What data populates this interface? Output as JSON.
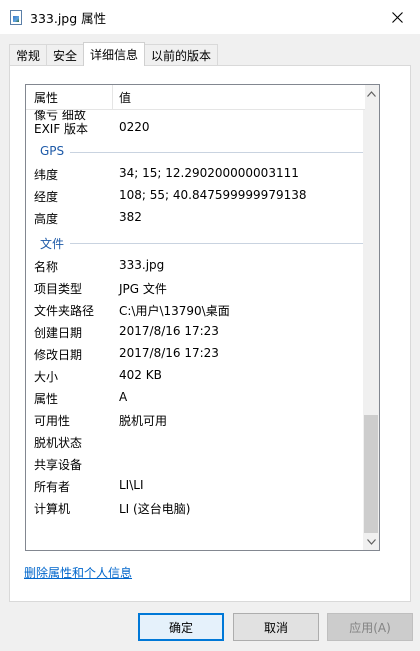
{
  "window": {
    "title": "333.jpg 属性"
  },
  "tabs": [
    {
      "label": "常规",
      "active": false
    },
    {
      "label": "安全",
      "active": false
    },
    {
      "label": "详细信息",
      "active": true
    },
    {
      "label": "以前的版本",
      "active": false
    }
  ],
  "list": {
    "header": {
      "property": "属性",
      "value": "值"
    },
    "cut_row": {
      "key": "像亏 细故"
    },
    "exif_row": {
      "key": "EXIF 版本",
      "value": "0220"
    },
    "gps": {
      "title": "GPS",
      "rows": [
        {
          "key": "纬度",
          "value": "34; 15; 12.290200000003111"
        },
        {
          "key": "经度",
          "value": "108; 55; 40.847599999979138"
        },
        {
          "key": "高度",
          "value": "382"
        }
      ]
    },
    "file": {
      "title": "文件",
      "rows": [
        {
          "key": "名称",
          "value": "333.jpg"
        },
        {
          "key": "项目类型",
          "value": "JPG 文件"
        },
        {
          "key": "文件夹路径",
          "value": "C:\\用户\\13790\\桌面"
        },
        {
          "key": "创建日期",
          "value": "2017/8/16 17:23"
        },
        {
          "key": "修改日期",
          "value": "2017/8/16 17:23"
        },
        {
          "key": "大小",
          "value": "402 KB"
        },
        {
          "key": "属性",
          "value": "A"
        },
        {
          "key": "可用性",
          "value": "脱机可用"
        },
        {
          "key": "脱机状态",
          "value": ""
        },
        {
          "key": "共享设备",
          "value": ""
        },
        {
          "key": "所有者",
          "value": "LI\\LI"
        },
        {
          "key": "计算机",
          "value": "LI (这台电脑)"
        }
      ]
    }
  },
  "link": {
    "label": "删除属性和个人信息"
  },
  "buttons": {
    "ok": "确定",
    "cancel": "取消",
    "apply": "应用(A)"
  },
  "colors": {
    "accent": "#0078d7",
    "link": "#0066cc",
    "section": "#1e5aa8"
  }
}
